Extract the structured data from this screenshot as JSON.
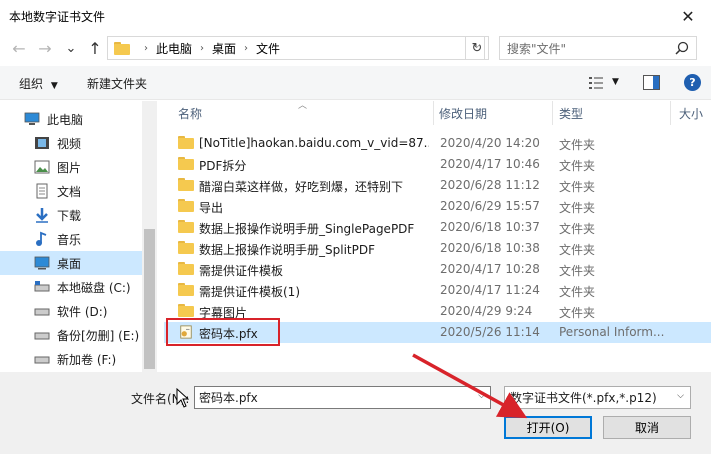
{
  "window": {
    "title": "本地数字证书文件",
    "close_glyph": "✕"
  },
  "nav": {
    "back": "←",
    "forward": "→",
    "recent": "⌄",
    "up": "↑",
    "breadcrumb": [
      "此电脑",
      "桌面",
      "文件"
    ],
    "refresh": "↻",
    "search_placeholder": "搜索\"文件\""
  },
  "toolbar": {
    "organize": "组织",
    "new_folder": "新建文件夹"
  },
  "sidebar": {
    "items": [
      {
        "label": "此电脑",
        "icon": "computer-icon"
      },
      {
        "label": "视频",
        "icon": "video-icon"
      },
      {
        "label": "图片",
        "icon": "picture-icon"
      },
      {
        "label": "文档",
        "icon": "document-icon"
      },
      {
        "label": "下载",
        "icon": "download-icon"
      },
      {
        "label": "音乐",
        "icon": "music-icon"
      },
      {
        "label": "桌面",
        "icon": "desktop-icon",
        "selected": true
      },
      {
        "label": "本地磁盘 (C:)",
        "icon": "drive-icon"
      },
      {
        "label": "软件 (D:)",
        "icon": "drive-icon"
      },
      {
        "label": "备份[勿删] (E:)",
        "icon": "drive-icon"
      },
      {
        "label": "新加卷 (F:)",
        "icon": "drive-icon"
      }
    ]
  },
  "columns": {
    "name": "名称",
    "date": "修改日期",
    "type": "类型",
    "size": "大小"
  },
  "files": [
    {
      "name": "[NoTitle]haokan.baidu.com_v_vid=87...",
      "date": "2020/4/20 14:20",
      "type": "文件夹"
    },
    {
      "name": "PDF拆分",
      "date": "2020/4/17 10:46",
      "type": "文件夹"
    },
    {
      "name": "醋溜白菜这样做，好吃到爆，还特别下",
      "date": "2020/6/28 11:12",
      "type": "文件夹"
    },
    {
      "name": "导出",
      "date": "2020/6/29 15:57",
      "type": "文件夹"
    },
    {
      "name": "数据上报操作说明手册_SinglePagePDF",
      "date": "2020/6/18 10:37",
      "type": "文件夹"
    },
    {
      "name": "数据上报操作说明手册_SplitPDF",
      "date": "2020/6/18 10:38",
      "type": "文件夹"
    },
    {
      "name": "需提供证件模板",
      "date": "2020/4/17 10:28",
      "type": "文件夹"
    },
    {
      "name": "需提供证件模板(1)",
      "date": "2020/4/17 11:24",
      "type": "文件夹"
    },
    {
      "name": "字幕图片",
      "date": "2020/4/29 9:24",
      "type": "文件夹"
    },
    {
      "name": "密码本.pfx",
      "date": "2020/5/26 11:14",
      "type": "Personal Inform...",
      "selected": true
    }
  ],
  "footer": {
    "filename_label": "文件名(N):",
    "filename_value": "密码本.pfx",
    "filetype": "数字证书文件(*.pfx,*.p12)",
    "open": "打开(O)",
    "cancel": "取消"
  },
  "colors": {
    "selection": "#cce8ff",
    "highlight_box": "#d8232a",
    "accent": "#0078d7"
  }
}
